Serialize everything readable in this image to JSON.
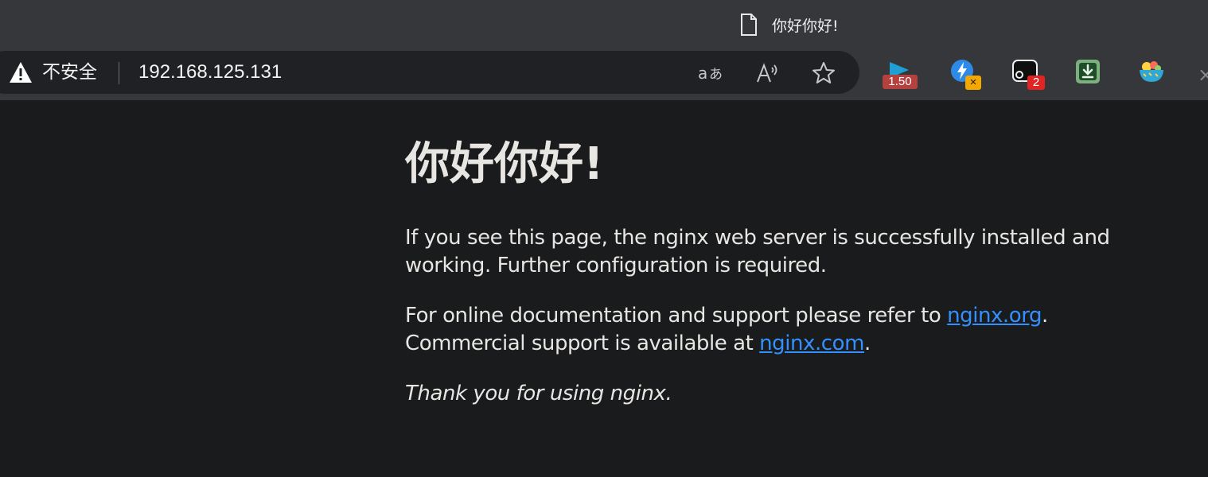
{
  "browser": {
    "tab": {
      "title": "你好你好!",
      "icon": "document-icon"
    },
    "address_bar": {
      "security_label": "不安全",
      "security_icon": "warning-icon",
      "url": "192.168.125.131",
      "actions": [
        "translate-icon",
        "read-aloud-icon",
        "favorite-star-icon"
      ]
    },
    "extensions": [
      {
        "name": "playback-speed-extension",
        "badge": "1.50",
        "badge_color": "#b5413f"
      },
      {
        "name": "bolt-extension",
        "badge": "×",
        "badge_color": "#f5a800"
      },
      {
        "name": "camera-extension",
        "badge": "2",
        "badge_color": "#e02424"
      },
      {
        "name": "download-extension",
        "badge": ""
      },
      {
        "name": "bowl-extension",
        "badge": ""
      }
    ]
  },
  "page": {
    "heading": "你好你好!",
    "paragraph1": "If you see this page, the nginx web server is successfully installed and working. Further configuration is required.",
    "paragraph2": {
      "text_before": "For online documentation and support please refer to ",
      "link1": "nginx.org",
      "text_middle": ".\nCommercial support is available at ",
      "link2": "nginx.com",
      "text_after": "."
    },
    "paragraph3": "Thank you for using nginx."
  },
  "colors": {
    "link": "#3391ff",
    "page_background": "#1a1b1d",
    "toolbar_background": "#36373b",
    "omnibox_background": "#202124"
  }
}
